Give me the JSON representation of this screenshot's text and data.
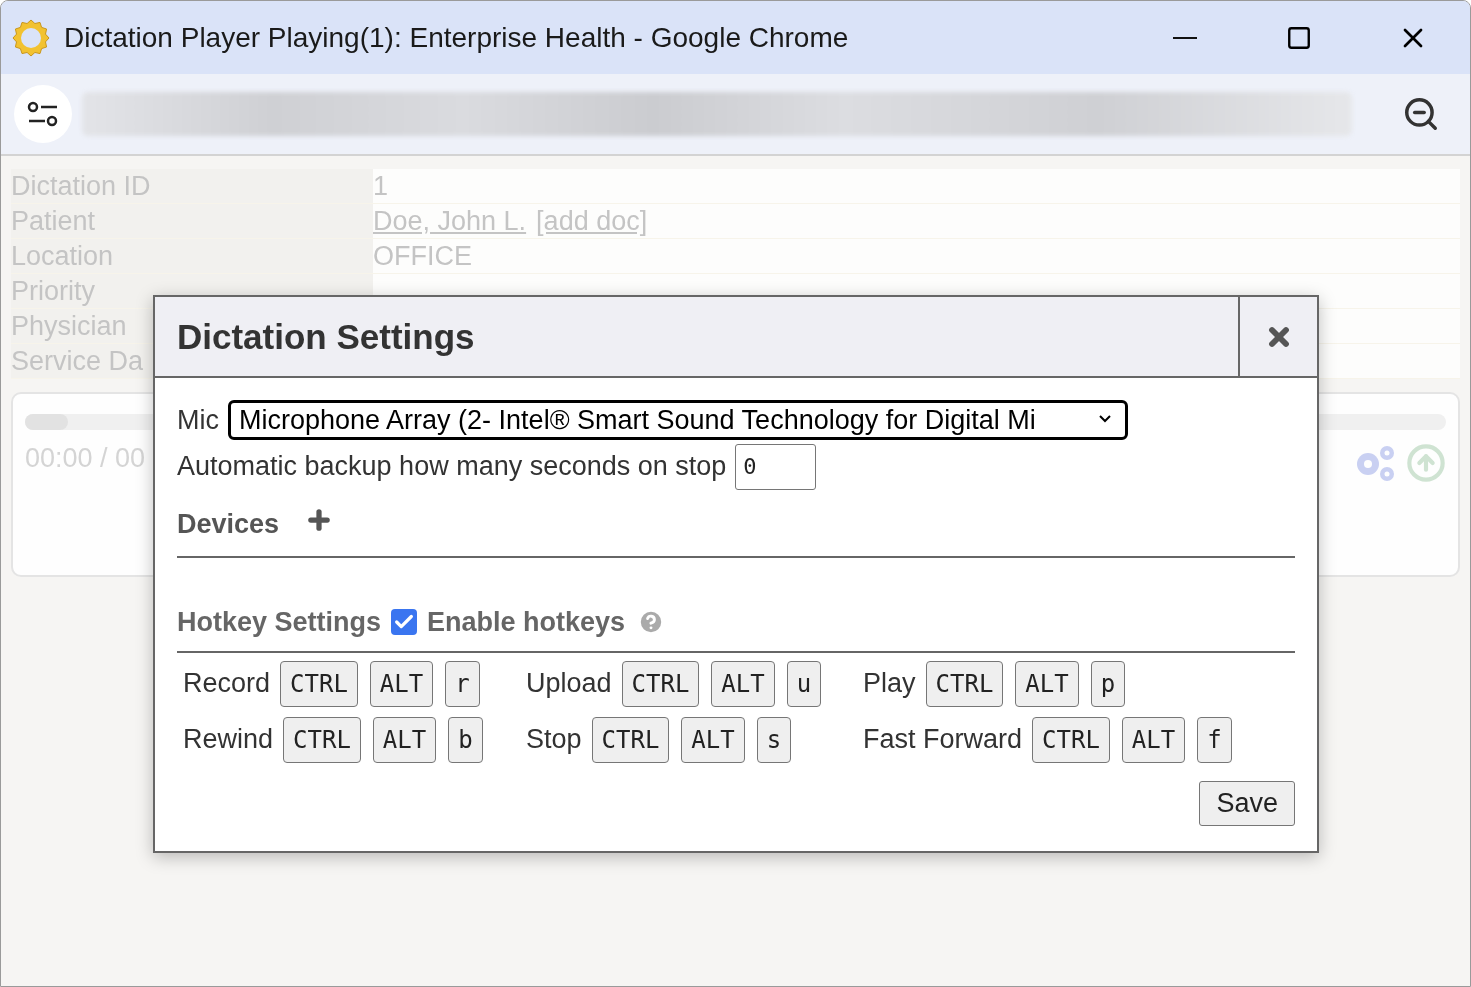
{
  "window": {
    "title": "Dictation Player Playing(1): Enterprise Health - Google Chrome"
  },
  "record": [
    {
      "label": "Dictation ID",
      "values": [
        {
          "text": "1",
          "link": false
        }
      ]
    },
    {
      "label": "Patient",
      "values": [
        {
          "text": "Doe, John L.",
          "link": true
        },
        {
          "text": "[add doc]",
          "link": true
        }
      ]
    },
    {
      "label": "Location",
      "values": [
        {
          "text": "OFFICE",
          "link": false
        }
      ]
    },
    {
      "label": "Priority"
    },
    {
      "label": "Physician"
    },
    {
      "label": "Service Da"
    }
  ],
  "player": {
    "time": "00:00 / 00",
    "level": 0.03
  },
  "dialog": {
    "title": "Dictation Settings",
    "mic": {
      "label": "Mic",
      "value": "Microphone Array (2- Intel® Smart Sound Technology for Digital Mi"
    },
    "backup": {
      "label": "Automatic backup how many seconds on stop",
      "value": "0"
    },
    "devices": {
      "label": "Devices"
    },
    "hotkeys": {
      "title": "Hotkey Settings",
      "enable": {
        "label": "Enable hotkeys",
        "checked": true
      },
      "actions": [
        {
          "label": "Record",
          "keys": [
            "CTRL",
            "ALT",
            "r"
          ]
        },
        {
          "label": "Upload",
          "keys": [
            "CTRL",
            "ALT",
            "u"
          ]
        },
        {
          "label": "Play",
          "keys": [
            "CTRL",
            "ALT",
            "p"
          ]
        },
        {
          "label": "Rewind",
          "keys": [
            "CTRL",
            "ALT",
            "b"
          ]
        },
        {
          "label": "Stop",
          "keys": [
            "CTRL",
            "ALT",
            "s"
          ]
        },
        {
          "label": "Fast Forward",
          "keys": [
            "CTRL",
            "ALT",
            "f"
          ]
        }
      ]
    },
    "save": "Save"
  }
}
